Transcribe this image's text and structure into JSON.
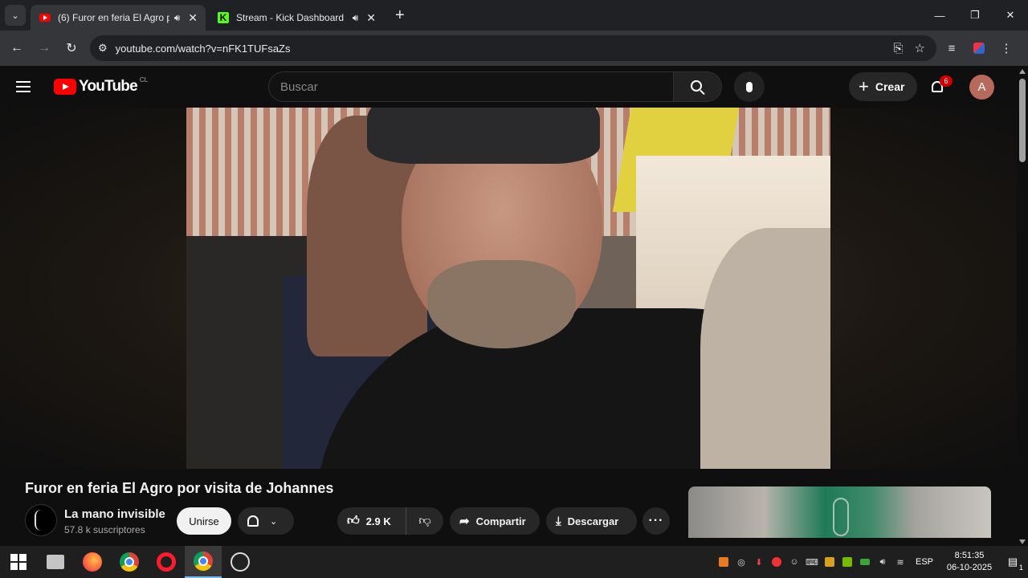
{
  "browser": {
    "tabs": [
      {
        "title": "(6) Furor en feria El Agro po",
        "favicon": "youtube-favicon",
        "active": true
      },
      {
        "title": "Stream - Kick Dashboard",
        "favicon": "kick-favicon",
        "active": false
      }
    ],
    "url": "youtube.com/watch?v=nFK1TUFsaZs"
  },
  "youtube": {
    "logo_text": "YouTube",
    "country_code": "CL",
    "search_placeholder": "Buscar",
    "create_label": "Crear",
    "notification_count": "6",
    "avatar_letter": "A"
  },
  "video": {
    "title": "Furor en feria El Agro por visita de Johannes",
    "channel_name": "La mano invisible",
    "subscribers": "57.8 k suscriptores",
    "join_label": "Unirse",
    "likes": "2.9 K",
    "share_label": "Compartir",
    "download_label": "Descargar"
  },
  "taskbar": {
    "language": "ESP",
    "time": "8:51:35",
    "date": "06-10-2025",
    "notification_count": "1"
  },
  "colors": {
    "youtube_red": "#ff0000",
    "kick_green": "#53fc18",
    "page_bg": "#0f0f0f",
    "button_bg": "#272727"
  }
}
